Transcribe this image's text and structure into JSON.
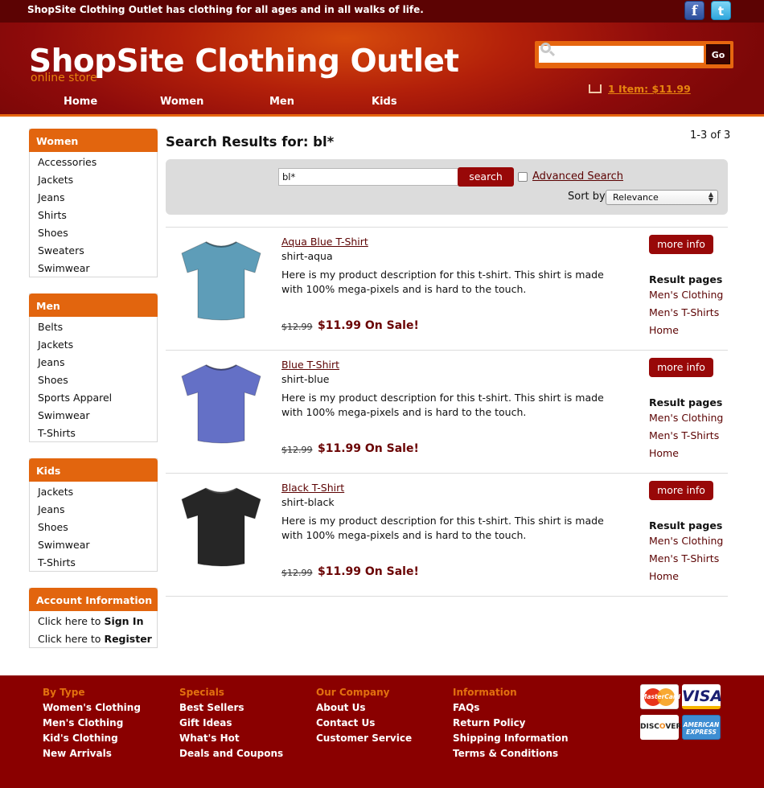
{
  "header": {
    "tagline": "ShopSite Clothing Outlet has clothing for all ages and in all walks of life.",
    "social": [
      {
        "icon": "facebook-icon",
        "glyph": "f"
      },
      {
        "icon": "twitter-icon",
        "glyph": "t"
      }
    ],
    "title": "ShopSite Clothing Outlet",
    "subtitle": "online store",
    "nav": [
      "Home",
      "Women",
      "Men",
      "Kids"
    ],
    "search": {
      "value": "",
      "go_label": "Go"
    },
    "cart": {
      "label": "1 Item: $11.99"
    }
  },
  "colors": {
    "brand_dark": "#5c0303",
    "accent_orange": "#e2650e",
    "button_red": "#980808"
  },
  "sidebar": {
    "women": {
      "title": "Women",
      "items": [
        "Accessories",
        "Jackets",
        "Jeans",
        "Shirts",
        "Shoes",
        "Sweaters",
        "Swimwear"
      ]
    },
    "men": {
      "title": "Men",
      "items": [
        "Belts",
        "Jackets",
        "Jeans",
        "Shoes",
        "Sports Apparel",
        "Swimwear",
        "T-Shirts"
      ]
    },
    "kids": {
      "title": "Kids",
      "items": [
        "Jackets",
        "Jeans",
        "Shoes",
        "Swimwear",
        "T-Shirts"
      ]
    },
    "account": {
      "title": "Account Information",
      "prefix": "Click here to",
      "signin": "Sign In",
      "register": "Register"
    }
  },
  "results": {
    "title": "Search Results for: bl*",
    "count": "1-3 of 3",
    "query": "bl*",
    "search_label": "search",
    "advanced_label": "Advanced Search",
    "sort_label": "Sort by:",
    "sort_value": "Relevance"
  },
  "products": [
    {
      "name": "Aqua Blue T-Shirt",
      "sku": "shirt-aqua",
      "desc": "Here is my product description for this t-shirt. This shirt is made with 100% mega-pixels and is hard to the touch.",
      "old_price": "$12.99",
      "sale": "$11.99 On Sale!",
      "color": "#5e9db8",
      "more": "more info",
      "rp_title": "Result pages",
      "rp": [
        "Men's Clothing",
        "Men's T-Shirts",
        "Home"
      ]
    },
    {
      "name": "Blue T-Shirt",
      "sku": "shirt-blue",
      "desc": "Here is my product description for this t-shirt. This shirt is made with 100% mega-pixels and is hard to the touch.",
      "old_price": "$12.99",
      "sale": "$11.99 On Sale!",
      "color": "#6470c6",
      "more": "more info",
      "rp_title": "Result pages",
      "rp": [
        "Men's Clothing",
        "Men's T-Shirts",
        "Home"
      ]
    },
    {
      "name": "Black T-Shirt",
      "sku": "shirt-black",
      "desc": "Here is my product description for this t-shirt. This shirt is made with 100% mega-pixels and is hard to the touch.",
      "old_price": "$12.99",
      "sale": "$11.99 On Sale!",
      "color": "#262626",
      "more": "more info",
      "rp_title": "Result pages",
      "rp": [
        "Men's Clothing",
        "Men's T-Shirts",
        "Home"
      ]
    }
  ],
  "footer": {
    "columns": [
      {
        "head": "By Type",
        "links": [
          "Women's Clothing",
          "Men's Clothing",
          "Kid's Clothing",
          "New Arrivals"
        ]
      },
      {
        "head": "Specials",
        "links": [
          "Best Sellers",
          "Gift Ideas",
          "What's Hot",
          "Deals and Coupons"
        ]
      },
      {
        "head": "Our Company",
        "links": [
          "About Us",
          "Contact Us",
          "Customer Service"
        ]
      },
      {
        "head": "Information",
        "links": [
          "FAQs",
          "Return Policy",
          "Shipping Information",
          "Terms & Conditions"
        ]
      }
    ],
    "cards": {
      "mastercard": "MasterCard",
      "visa": "VISA",
      "discover_a": "DISC",
      "discover_o": "O",
      "discover_b": "VER",
      "amex_a": "AMERICAN",
      "amex_b": "EXPRESS"
    }
  }
}
